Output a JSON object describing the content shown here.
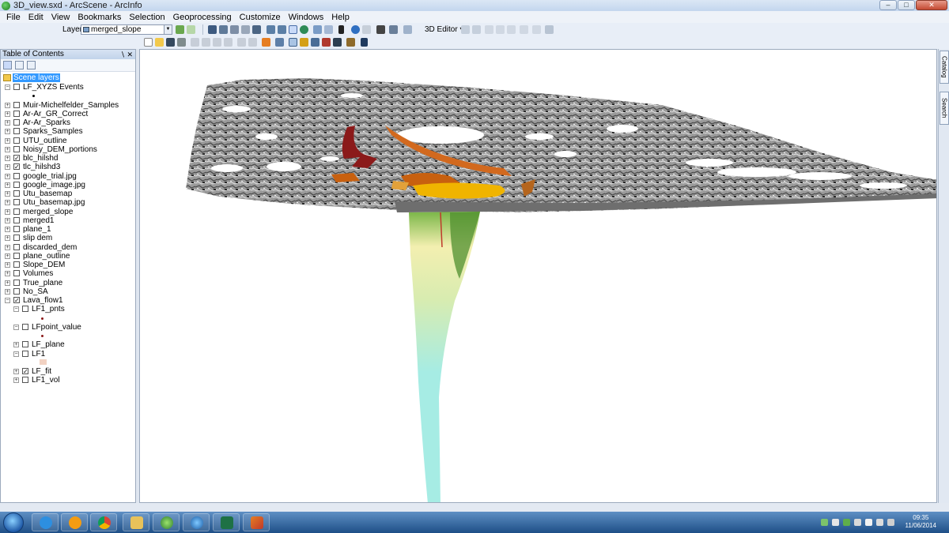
{
  "window": {
    "title": "3D_view.sxd - ArcScene - ArcInfo"
  },
  "menu": [
    "File",
    "Edit",
    "View",
    "Bookmarks",
    "Selection",
    "Geoprocessing",
    "Customize",
    "Windows",
    "Help"
  ],
  "toolbar": {
    "layer_label": "Layer:",
    "layer_value": "merged_slope",
    "editor_label": "3D Editor ▾"
  },
  "toc": {
    "title": "Table of Contents",
    "root": "Scene layers",
    "layers": [
      {
        "label": "LF_XYZS Events",
        "expander": "−",
        "checked": false,
        "indent": 0,
        "symbol": "dot-black"
      },
      {
        "label": "Muir-Michelfelder_Samples",
        "expander": "+",
        "checked": false,
        "indent": 0
      },
      {
        "label": "Ar-Ar_GR_Correct",
        "expander": "+",
        "checked": false,
        "indent": 0
      },
      {
        "label": "Ar-Ar_Sparks",
        "expander": "+",
        "checked": false,
        "indent": 0
      },
      {
        "label": "Sparks_Samples",
        "expander": "+",
        "checked": false,
        "indent": 0
      },
      {
        "label": "UTU_outline",
        "expander": "+",
        "checked": false,
        "indent": 0
      },
      {
        "label": "Noisy_DEM_portions",
        "expander": "+",
        "checked": false,
        "indent": 0
      },
      {
        "label": "blc_hilshd",
        "expander": "+",
        "checked": true,
        "indent": 0
      },
      {
        "label": "tlc_hilshd3",
        "expander": "+",
        "checked": true,
        "indent": 0
      },
      {
        "label": "google_trial.jpg",
        "expander": "+",
        "checked": false,
        "indent": 0
      },
      {
        "label": "google_image.jpg",
        "expander": "+",
        "checked": false,
        "indent": 0
      },
      {
        "label": "Utu_basemap",
        "expander": "+",
        "checked": false,
        "indent": 0
      },
      {
        "label": "Utu_basemap.jpg",
        "expander": "+",
        "checked": false,
        "indent": 0
      },
      {
        "label": "merged_slope",
        "expander": "+",
        "checked": false,
        "indent": 0
      },
      {
        "label": "merged1",
        "expander": "+",
        "checked": false,
        "indent": 0
      },
      {
        "label": "plane_1",
        "expander": "+",
        "checked": false,
        "indent": 0
      },
      {
        "label": "slip dem",
        "expander": "+",
        "checked": false,
        "indent": 0
      },
      {
        "label": "discarded_dem",
        "expander": "+",
        "checked": false,
        "indent": 0
      },
      {
        "label": "plane_outline",
        "expander": "+",
        "checked": false,
        "indent": 0
      },
      {
        "label": "Slope_DEM",
        "expander": "+",
        "checked": false,
        "indent": 0
      },
      {
        "label": "Volumes",
        "expander": "+",
        "checked": false,
        "indent": 0
      },
      {
        "label": "True_plane",
        "expander": "+",
        "checked": false,
        "indent": 0
      },
      {
        "label": "No_SA",
        "expander": "+",
        "checked": false,
        "indent": 0
      },
      {
        "label": "Lava_flow1",
        "expander": "−",
        "checked": true,
        "indent": 0
      },
      {
        "label": "LF1_pnts",
        "expander": "−",
        "checked": false,
        "indent": 1,
        "symbol": "dot-red"
      },
      {
        "label": "LFpoint_value",
        "expander": "−",
        "checked": false,
        "indent": 1,
        "symbol": "dot-red"
      },
      {
        "label": "LF_plane",
        "expander": "+",
        "checked": false,
        "indent": 1
      },
      {
        "label": "LF1",
        "expander": "−",
        "checked": false,
        "indent": 1,
        "symbol": "square-pink"
      },
      {
        "label": "LF_fit",
        "expander": "+",
        "checked": true,
        "indent": 1
      },
      {
        "label": "LF1_vol",
        "expander": "+",
        "checked": false,
        "indent": 1
      }
    ]
  },
  "dock": {
    "catalog": "Catalog",
    "search": "Search"
  },
  "taskbar": {
    "time": "09:35",
    "date": "11/06/2014"
  },
  "colors": {
    "lava_red": "#8b1a1a",
    "lava_orange": "#d2691e",
    "lava_yellow": "#f0b400",
    "slip_green": "#7ab648",
    "slip_cyan": "#a6ece4"
  }
}
